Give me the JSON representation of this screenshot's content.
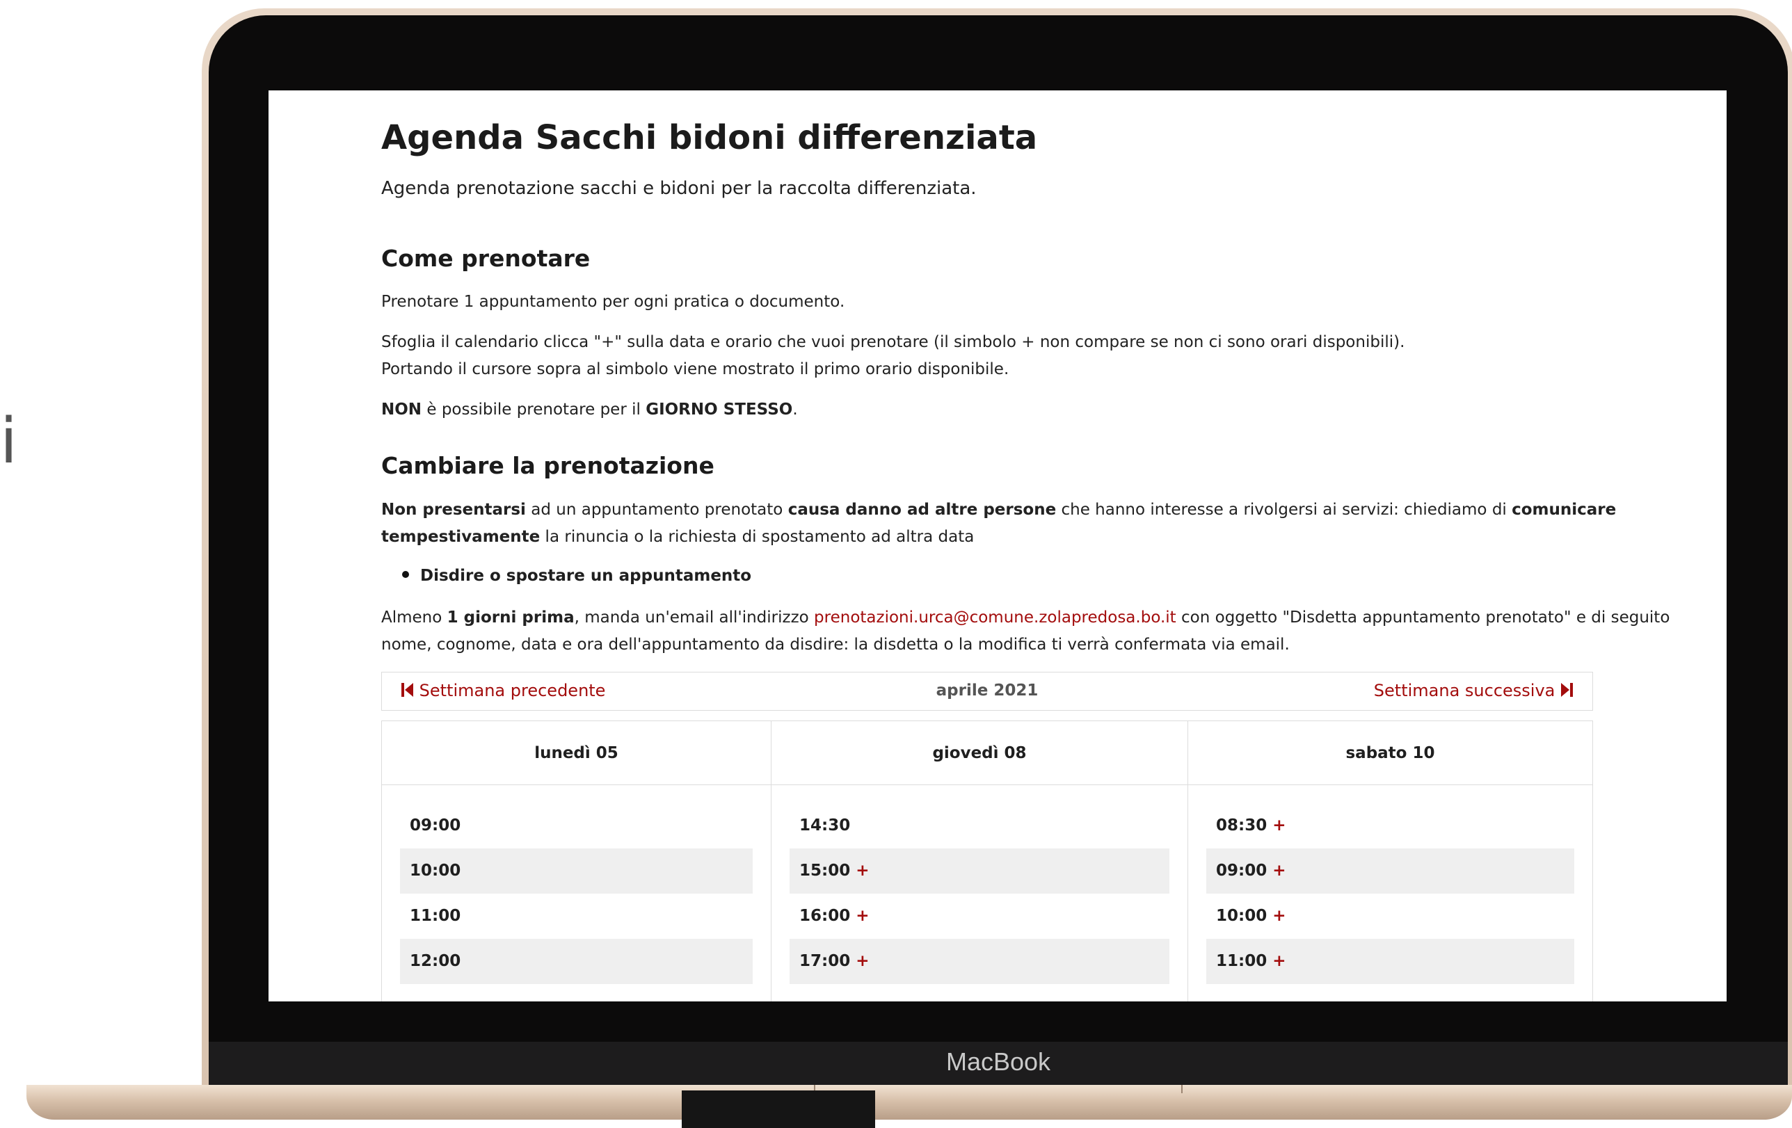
{
  "side_fragment": "i",
  "device_brand": "MacBook",
  "page": {
    "title": "Agenda Sacchi bidoni differenziata",
    "intro": "Agenda prenotazione sacchi e bidoni per la raccolta differenziata."
  },
  "how_to_book": {
    "heading": "Come prenotare",
    "line1": "Prenotare 1 appuntamento per ogni pratica o documento.",
    "line2": "Sfoglia il calendario clicca \"+\" sulla data e orario che vuoi prenotare (il simbolo + non compare se non ci sono orari disponibili).",
    "line3": "Portando il cursore sopra al simbolo viene mostrato il primo orario disponibile.",
    "line4_b1": "NON",
    "line4_t1": " è possibile prenotare per il ",
    "line4_b2": "GIORNO STESSO",
    "line4_t2": "."
  },
  "change_booking": {
    "heading": "Cambiare la prenotazione",
    "p1_b1": "Non presentarsi",
    "p1_t1": " ad un appuntamento prenotato ",
    "p1_b2": "causa danno ad altre persone",
    "p1_t2": " che hanno interesse a rivolgersi ai servizi: chiediamo di ",
    "p1_b3": "comunicare",
    "p1_b4": "tempestivamente",
    "p1_t3": " la rinuncia o la richiesta di spostamento ad altra data",
    "bullet": "Disdire o spostare un appuntamento",
    "p2_t1": "Almeno ",
    "p2_b1": "1 giorni prima",
    "p2_t2": ", manda un'email all'indirizzo ",
    "p2_email": "prenotazioni.urca@comune.zolapredosa.bo.it",
    "p2_t3": " con oggetto \"Disdetta appuntamento prenotato\" e di seguito",
    "p2_line2": "nome, cognome, data e ora dell'appuntamento da disdire: la disdetta o la modifica ti verrà confermata via email."
  },
  "calendar": {
    "prev_label": "Settimana precedente",
    "next_label": "Settimana successiva",
    "month": "aprile 2021",
    "days": [
      {
        "label": "lunedì 05",
        "slots": [
          {
            "time": "09:00",
            "plus": ""
          },
          {
            "time": "10:00",
            "plus": ""
          },
          {
            "time": "11:00",
            "plus": ""
          },
          {
            "time": "12:00",
            "plus": ""
          }
        ]
      },
      {
        "label": "giovedì 08",
        "slots": [
          {
            "time": "14:30",
            "plus": ""
          },
          {
            "time": "15:00",
            "plus": "+"
          },
          {
            "time": "16:00",
            "plus": "+"
          },
          {
            "time": "17:00",
            "plus": "+"
          }
        ]
      },
      {
        "label": "sabato 10",
        "slots": [
          {
            "time": "08:30",
            "plus": "+"
          },
          {
            "time": "09:00",
            "plus": "+"
          },
          {
            "time": "10:00",
            "plus": "+"
          },
          {
            "time": "11:00",
            "plus": "+"
          }
        ]
      }
    ]
  },
  "colors": {
    "accent": "#a30d0d",
    "slot_alt_bg": "#efefef",
    "border": "#dcdcdc"
  }
}
